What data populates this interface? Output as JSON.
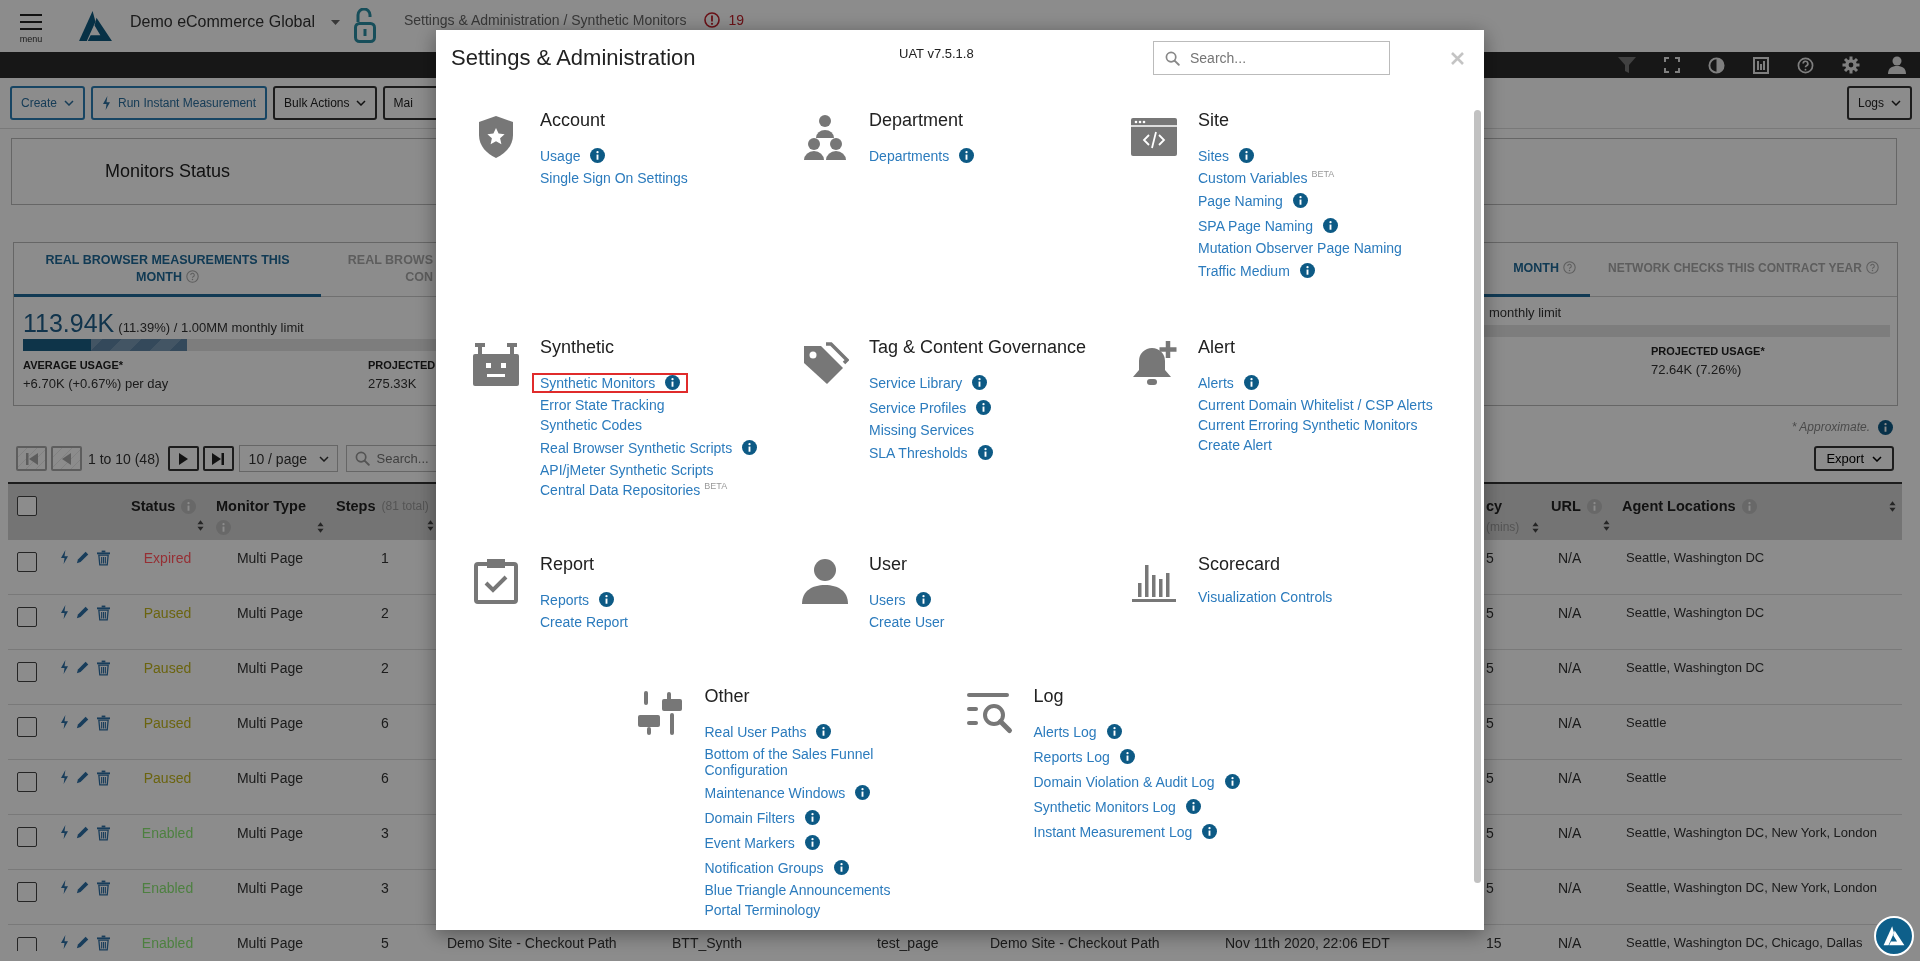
{
  "header": {
    "menu_label": "menu",
    "org": "Demo eCommerce Global",
    "breadcrumb": "Settings & Administration / Synthetic Monitors",
    "alert_count": "19"
  },
  "toolbar": {
    "buttons": [
      {
        "label": "Create",
        "kind": "primary-dropdown"
      },
      {
        "label": "Run Instant Measurement",
        "kind": "primary-action"
      },
      {
        "label": "Bulk Actions",
        "kind": "dropdown"
      },
      {
        "label": "Mai",
        "kind": "plain"
      }
    ],
    "right_buttons": [
      {
        "label": "Logs",
        "kind": "dropdown"
      }
    ]
  },
  "monitors_status": {
    "title": "Monitors Status"
  },
  "usage": {
    "tabs": [
      {
        "label": "REAL BROWSER MEASUREMENTS THIS MONTH",
        "selected": true,
        "help": true
      },
      {
        "label": "REAL BROWS CON",
        "selected": false,
        "help": false
      },
      {
        "label": "MONTH",
        "selected": true,
        "help": true
      },
      {
        "label": "NETWORK CHECKS THIS CONTRACT YEAR",
        "selected": false,
        "help": true
      }
    ],
    "left": {
      "value": "113.94K",
      "detail": "(11.39%) / 1.00MM monthly limit",
      "bar": {
        "level": 0.1139,
        "projection": {
          "level": 0.2753
        }
      },
      "stats": [
        {
          "label": "AVERAGE USAGE*",
          "value": "+6.70K (+0.67%) per day"
        },
        {
          "label": "PROJECTED",
          "value": "275.33K"
        }
      ]
    },
    "right": {
      "detail": "monthly limit",
      "stats": [
        {
          "label": "PROJECTED USAGE*",
          "value": "72.64K (7.26%)"
        }
      ]
    }
  },
  "approx_note": "* Approximate.",
  "pagination": {
    "buttons": [
      {
        "kind": "first",
        "disabled": true
      },
      {
        "kind": "prev",
        "disabled": true
      },
      {
        "kind": "next",
        "disabled": false
      },
      {
        "kind": "last",
        "disabled": false
      }
    ],
    "range": "1 to 10 (48)",
    "page_size": "10 / page",
    "search_placeholder": "Search..."
  },
  "export": {
    "label": "Export"
  },
  "table": {
    "columns": [
      {
        "kind": "select",
        "checked": false
      },
      {
        "kind": "actions"
      },
      {
        "kind": "data",
        "label": "Status",
        "info": true
      },
      {
        "kind": "data",
        "label": "Monitor Type",
        "info": true
      },
      {
        "kind": "data",
        "label": "Steps",
        "note": "(81 total)",
        "info": false
      },
      {
        "kind": "hidden"
      },
      {
        "kind": "hidden"
      },
      {
        "kind": "hidden"
      },
      {
        "kind": "hidden"
      },
      {
        "kind": "hidden"
      },
      {
        "kind": "data",
        "label": "cy",
        "note": "(mins)",
        "info": false
      },
      {
        "kind": "data",
        "label": "URL",
        "info": true
      },
      {
        "kind": "data",
        "label": "Agent Locations",
        "info": true
      }
    ],
    "rows": [
      {
        "checked": false,
        "status": "Expired",
        "color": "#952f34",
        "monitor_type": "Multi Page",
        "steps": "1",
        "column_11": "5",
        "url": "N/A",
        "agent_locations": "Seattle, Washington DC"
      },
      {
        "checked": false,
        "status": "Paused",
        "color": "#6b640f",
        "monitor_type": "Multi Page",
        "steps": "2",
        "column_11": "5",
        "url": "N/A",
        "agent_locations": "Seattle, Washington DC"
      },
      {
        "checked": false,
        "status": "Paused",
        "color": "#6b640f",
        "monitor_type": "Multi Page",
        "steps": "2",
        "column_11": "5",
        "url": "N/A",
        "agent_locations": "Seattle, Washington DC"
      },
      {
        "checked": false,
        "status": "Paused",
        "color": "#6b640f",
        "monitor_type": "Multi Page",
        "steps": "6",
        "column_11": "5",
        "url": "N/A",
        "agent_locations": "Seattle"
      },
      {
        "checked": false,
        "status": "Paused",
        "color": "#6b640f",
        "monitor_type": "Multi Page",
        "steps": "6",
        "column_11": "5",
        "url": "N/A",
        "agent_locations": "Seattle"
      },
      {
        "checked": false,
        "status": "Enabled",
        "color": "#4d8040",
        "monitor_type": "Multi Page",
        "steps": "3",
        "column_11": "5",
        "url": "N/A",
        "agent_locations": "Seattle, Washington DC, New York, London"
      },
      {
        "checked": false,
        "status": "Enabled",
        "color": "#4d8040",
        "monitor_type": "Multi Page",
        "steps": "3",
        "column_11": "5",
        "url": "N/A",
        "agent_locations": "Seattle, Washington DC, New York, London"
      },
      {
        "checked": false,
        "status": "Enabled",
        "color": "#4d8040",
        "monitor_type": "Multi Page",
        "steps": "5",
        "column_6": "Demo Site - Checkout Path",
        "column_7": "BTT_Synth",
        "column_8": "test_page",
        "column_9": "Demo Site - Checkout Path",
        "column_10": "Nov 11th 2020, 22:06 EDT",
        "column_11": "15",
        "url": "N/A",
        "agent_locations": "Seattle, Washington DC, Chicago, Dallas"
      }
    ]
  },
  "modal": {
    "title": "Settings & Administration",
    "version": "UAT v7.5.1.8",
    "search_placeholder": "Search...",
    "rows": [
      {
        "sections": [
          {
            "title": "Account",
            "links": [
              {
                "label": "Usage",
                "info": true,
                "highlighted": false
              },
              {
                "label": "Single Sign On Settings",
                "info": false,
                "highlighted": false
              }
            ]
          },
          {
            "title": "Department",
            "links": [
              {
                "label": "Departments",
                "info": true,
                "highlighted": false
              }
            ]
          },
          {
            "title": "Site",
            "links": [
              {
                "label": "Sites",
                "info": true,
                "highlighted": false
              },
              {
                "label": "Custom Variables",
                "badge": "BETA",
                "info": false,
                "highlighted": false
              },
              {
                "label": "Page Naming",
                "info": true,
                "highlighted": false
              },
              {
                "label": "SPA Page Naming",
                "info": true,
                "highlighted": false
              },
              {
                "label": "Mutation Observer Page Naming",
                "info": false,
                "highlighted": false
              },
              {
                "label": "Traffic Medium",
                "info": true,
                "highlighted": false
              }
            ]
          }
        ]
      },
      {
        "sections": [
          {
            "title": "Synthetic",
            "links": [
              {
                "label": "Synthetic Monitors",
                "info": true,
                "highlighted": true
              },
              {
                "label": "Error State Tracking",
                "info": false,
                "highlighted": false
              },
              {
                "label": "Synthetic Codes",
                "info": false,
                "highlighted": false
              },
              {
                "label": "Real Browser Synthetic Scripts",
                "info": true,
                "highlighted": false
              },
              {
                "label": "API/jMeter Synthetic Scripts",
                "info": false,
                "highlighted": false
              },
              {
                "label": "Central Data Repositories",
                "badge": "BETA",
                "info": false,
                "highlighted": false
              }
            ]
          },
          {
            "title": "Tag & Content Governance",
            "links": [
              {
                "label": "Service Library",
                "info": true,
                "highlighted": false
              },
              {
                "label": "Service Profiles",
                "info": true,
                "highlighted": false
              },
              {
                "label": "Missing Services",
                "info": false,
                "highlighted": false
              },
              {
                "label": "SLA Thresholds",
                "info": true,
                "highlighted": false
              }
            ]
          },
          {
            "title": "Alert",
            "links": [
              {
                "label": "Alerts",
                "info": true,
                "highlighted": false
              },
              {
                "label": "Current Domain Whitelist / CSP Alerts",
                "info": false,
                "highlighted": false
              },
              {
                "label": "Current Erroring Synthetic Monitors",
                "info": false,
                "highlighted": false
              },
              {
                "label": "Create Alert",
                "info": false,
                "highlighted": false
              }
            ]
          }
        ]
      },
      {
        "sections": [
          {
            "title": "Report",
            "links": [
              {
                "label": "Reports",
                "info": true,
                "highlighted": false
              },
              {
                "label": "Create Report",
                "info": false,
                "highlighted": false
              }
            ]
          },
          {
            "title": "User",
            "links": [
              {
                "label": "Users",
                "info": true,
                "highlighted": false
              },
              {
                "label": "Create User",
                "info": false,
                "highlighted": false
              }
            ]
          },
          {
            "title": "Scorecard",
            "links": [
              {
                "label": "Visualization Controls",
                "info": false,
                "highlighted": false
              }
            ]
          }
        ]
      },
      {
        "sections": [
          {
            "title": "Other",
            "links": [
              {
                "label": "Real User Paths",
                "info": true,
                "highlighted": false
              },
              {
                "label": "Bottom of the Sales Funnel Configuration",
                "info": false,
                "highlighted": false
              },
              {
                "label": "Maintenance Windows",
                "info": true,
                "highlighted": false
              },
              {
                "label": "Domain Filters",
                "info": true,
                "highlighted": false
              },
              {
                "label": "Event Markers",
                "info": true,
                "highlighted": false
              },
              {
                "label": "Notification Groups",
                "info": true,
                "highlighted": false
              },
              {
                "label": "Blue Triangle Announcements",
                "info": false,
                "highlighted": false
              },
              {
                "label": "Portal Terminology",
                "info": false,
                "highlighted": false
              }
            ]
          },
          {
            "title": "Log",
            "links": [
              {
                "label": "Alerts Log",
                "info": true,
                "highlighted": false
              },
              {
                "label": "Reports Log",
                "info": true,
                "highlighted": false
              },
              {
                "label": "Domain Violation & Audit Log",
                "info": true,
                "highlighted": false
              },
              {
                "label": "Synthetic Monitors Log",
                "info": true,
                "highlighted": false
              },
              {
                "label": "Instant Measurement Log",
                "info": true,
                "highlighted": false
              }
            ]
          }
        ]
      }
    ]
  }
}
